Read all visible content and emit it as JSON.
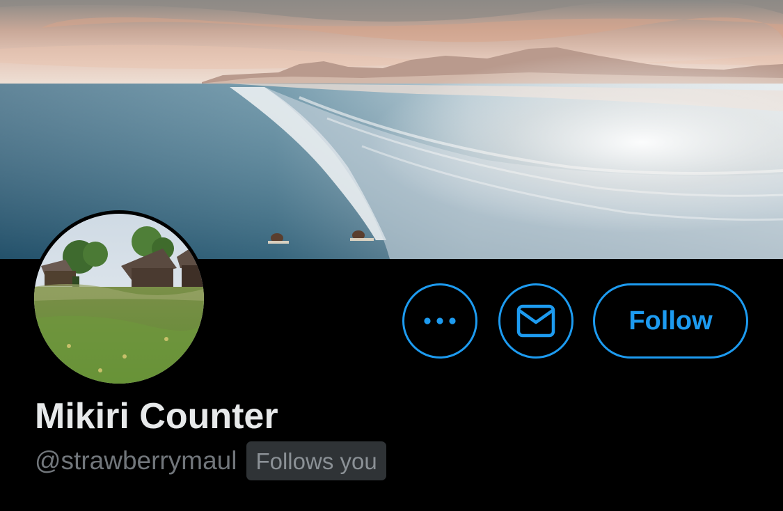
{
  "profile": {
    "display_name": "Mikiri Counter",
    "handle": "@strawberrymaul",
    "follows_you_label": "Follows you"
  },
  "actions": {
    "more_icon": "more-horizontal-icon",
    "message_icon": "envelope-icon",
    "follow_label": "Follow"
  },
  "images": {
    "banner": "ocean-beach-surfers-sunset",
    "avatar": "meadow-with-wooden-cabins"
  },
  "colors": {
    "background": "#000000",
    "accent": "#1d9bf0",
    "name_text": "#e7e9ea",
    "secondary_text": "#71767b",
    "badge_background": "#2f3336"
  }
}
